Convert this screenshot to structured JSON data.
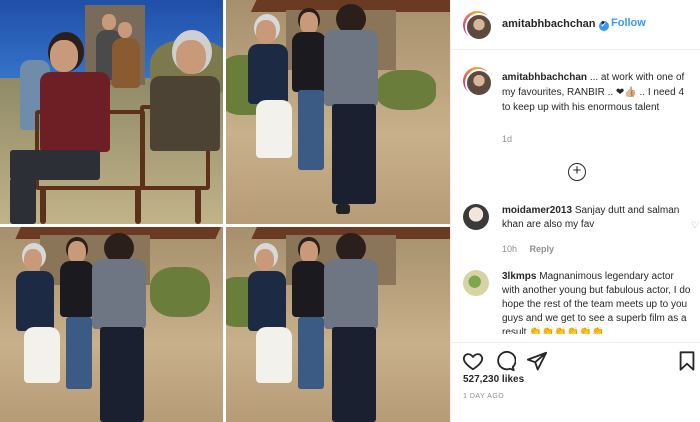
{
  "post": {
    "username": "amitabhbachchan",
    "verified_mark": "✓",
    "separator": "•",
    "follow_label": "Follow",
    "caption": {
      "username": "amitabhbachchan",
      "text": "... at work with one of my favourites, RANBIR .. ❤👍🏼 .. I need 4 to keep up with his enormous talent"
    },
    "time_ago": "1d",
    "load_more_icon": "plus-circle-icon",
    "likes": "527,230 likes",
    "posted": "1 DAY AGO"
  },
  "comments": [
    {
      "username": "moidamer2013",
      "text": "Sanjay dutt and salman khan are also my fav",
      "time": "10h",
      "reply_label": "Reply"
    },
    {
      "username": "3lkmps",
      "text": "Magnanimous legendary actor with another young but fabulous actor, I do hope the rest of the team meets up to you guys and we get to see a superb film as a result 👏👏👏👏👏👏"
    }
  ],
  "actions": {
    "like_icon": "heart-icon",
    "comment_icon": "comment-icon",
    "share_icon": "share-icon",
    "save_icon": "bookmark-icon"
  },
  "colors": {
    "accent": "#3897f0",
    "text": "#262626",
    "muted": "#8e8e8e",
    "border": "#efefef"
  }
}
